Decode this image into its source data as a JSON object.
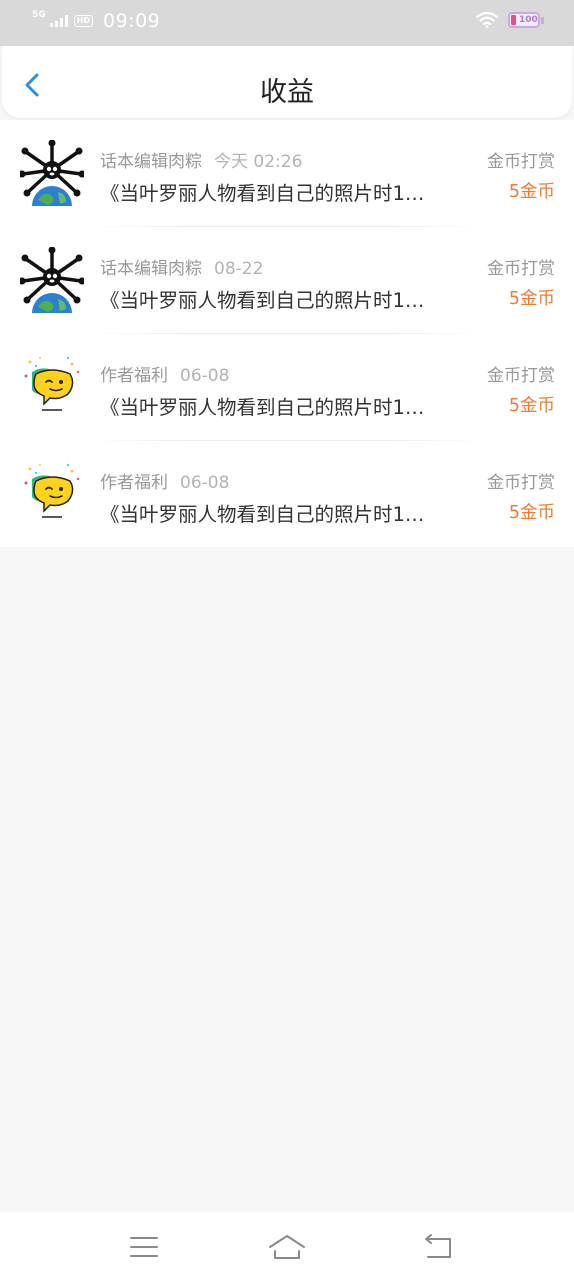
{
  "status_bar": {
    "network": "5G",
    "hd": "HD",
    "time": "09:09",
    "battery_level": "100"
  },
  "header": {
    "title": "收益"
  },
  "records": [
    {
      "sender": "话本编辑肉粽",
      "date": "今天 02:26",
      "description": "《当叶罗丽人物看到自己的照片时1…",
      "type": "金币打赏",
      "amount": "5金币",
      "avatar": "cartoon-globe-avatar"
    },
    {
      "sender": "话本编辑肉粽",
      "date": "08-22",
      "description": "《当叶罗丽人物看到自己的照片时1…",
      "type": "金币打赏",
      "amount": "5金币",
      "avatar": "cartoon-globe-avatar"
    },
    {
      "sender": "作者福利",
      "date": "06-08",
      "description": "《当叶罗丽人物看到自己的照片时1…",
      "type": "金币打赏",
      "amount": "5金币",
      "avatar": "yellow-chat-bubble-avatar"
    },
    {
      "sender": "作者福利",
      "date": "06-08",
      "description": "《当叶罗丽人物看到自己的照片时1…",
      "type": "金币打赏",
      "amount": "5金币",
      "avatar": "yellow-chat-bubble-avatar"
    }
  ],
  "colors": {
    "accent_blue": "#2b8fe0",
    "amount_orange": "#ee7d33"
  },
  "nav_icons": [
    "menu-icon",
    "home-icon",
    "back-icon"
  ]
}
